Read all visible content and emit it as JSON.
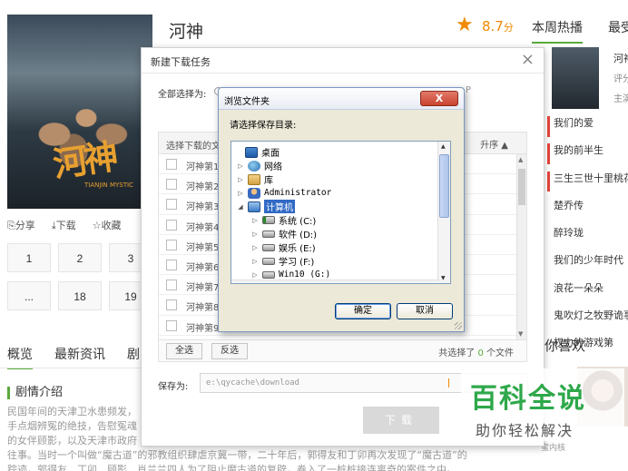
{
  "page": {
    "title": "河神",
    "rating": "8.7",
    "rating_unit": "分",
    "tabs_right": [
      "本周热播",
      "最受"
    ],
    "poster_logo": "河神",
    "poster_sub": "TIANJIN MYSTIC",
    "actions": [
      "分享",
      "下载",
      "收藏"
    ],
    "episodes_row1": [
      "1",
      "2",
      "3"
    ],
    "episodes_row2": [
      "...",
      "18",
      "19"
    ],
    "feature": {
      "title": "河神",
      "meta": "评分",
      "meta2": "主演"
    },
    "hot_list": [
      "我们的爱",
      "我的前半生",
      "三生三世十里桃花",
      "楚乔传",
      "醉玲珑",
      "我们的少年时代",
      "浪花一朵朵",
      "鬼吹灯之牧野诡事",
      "权力的游戏第"
    ],
    "guess_title": "你喜欢",
    "guess_caption": "蜜内核",
    "bottom_tabs": [
      "概览",
      "最新资讯",
      "剧"
    ],
    "plot_heading": "剧情介绍",
    "plot_lines": [
      "民国年间的天津卫水患频发，",
      "手点烟辨冤的绝技，告慰冤魂",
      "的女伴顾影，以及天津市政府",
      "往事。当时一个叫做“魔古道”的邪教组织肆虐京冀一带，二十年后，郭得友和丁卯再次发现了“魔古道”的",
      "踪迹，郭得友、丁卯、顾影、肖兰兰四人为了阻止魔古道的复辟，卷入了一桩桩接连离奇的案件之中。"
    ],
    "colors": {
      "accent": "#5aab3c",
      "rating": "#f08a00"
    }
  },
  "task_dialog": {
    "title": "新建下载任务",
    "close_icon": "×",
    "select_all_label": "全部选择为:",
    "hidden_options": [
      "",
      "",
      "P"
    ],
    "table_header": "选择下载的文",
    "sort_label": "升序",
    "sort_icon": "▲",
    "rows": [
      "河神第1",
      "河神第2",
      "河神第3",
      "河神第4",
      "河神第5",
      "河神第6",
      "河神第7",
      "河神第8",
      "河神第9"
    ],
    "btn_all": "全选",
    "btn_invert": "反选",
    "count_prefix": "共选择了",
    "count_value": "0",
    "count_suffix": "个文件",
    "save_label": "保存为:",
    "save_path": "e:\\qycache\\download",
    "download_button": "下载"
  },
  "browse_dialog": {
    "title": "浏览文件夹",
    "close_label": "X",
    "prompt": "请选择保存目录:",
    "tree": [
      {
        "label": "桌面",
        "icon": "desktop-icon",
        "level": 0,
        "expander": "",
        "cn": true
      },
      {
        "label": "网络",
        "icon": "network-icon",
        "level": 1,
        "expander": "▷",
        "cn": true
      },
      {
        "label": "库",
        "icon": "library-icon",
        "level": 1,
        "expander": "▷",
        "cn": true
      },
      {
        "label": "Administrator",
        "icon": "user-icon",
        "level": 1,
        "expander": "▷",
        "cn": false
      },
      {
        "label": "计算机",
        "icon": "computer-icon",
        "level": 1,
        "expander": "◢",
        "cn": true,
        "selected": true
      },
      {
        "label": "系统 (C:)",
        "icon": "system-drive-icon",
        "level": 2,
        "expander": "▷",
        "cn": true
      },
      {
        "label": "软件 (D:)",
        "icon": "drive-icon",
        "level": 2,
        "expander": "▷",
        "cn": true
      },
      {
        "label": "娱乐 (E:)",
        "icon": "drive-icon",
        "level": 2,
        "expander": "▷",
        "cn": true
      },
      {
        "label": "学习 (F:)",
        "icon": "drive-icon",
        "level": 2,
        "expander": "▷",
        "cn": true
      },
      {
        "label": "Win10 (G:)",
        "icon": "drive-icon",
        "level": 2,
        "expander": "▷",
        "cn": false
      }
    ],
    "ok_label": "确定",
    "cancel_label": "取消"
  },
  "watermark": {
    "big": "百科全说",
    "small": "助你轻松解决"
  }
}
